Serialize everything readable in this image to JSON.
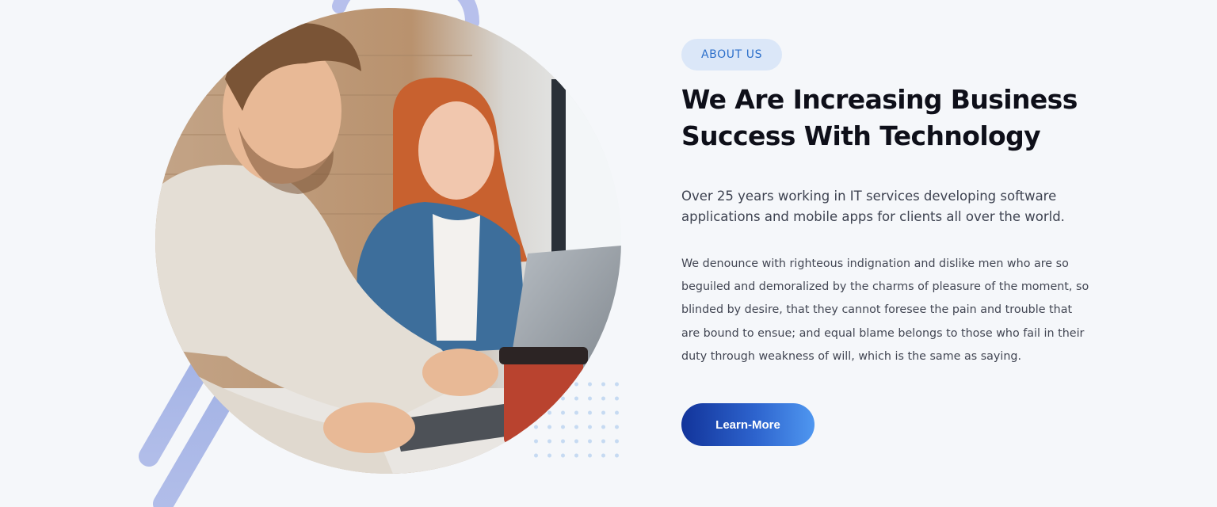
{
  "about": {
    "badge": "ABOUT US",
    "title": "We Are Increasing Business Success With Technology",
    "lead": "Over 25 years working in IT services developing software applications and mobile apps for clients all over the world.",
    "body": "We denounce with righteous indignation and dislike men who are so beguiled and demoralized by the charms of pleasure of the moment, so blinded by desire, that they cannot foresee the pain and trouble that are bound to ensue; and equal blame belongs to those who fail in their duty through weakness of will, which is the same as saying.",
    "cta_label": "Learn-More"
  },
  "colors": {
    "badge_bg": "#dbe7f8",
    "badge_text": "#2c6fca",
    "heading": "#0e0f19",
    "cta_start": "#12349a",
    "cta_end": "#4f97f0",
    "stripe": "#a9b6e6"
  }
}
